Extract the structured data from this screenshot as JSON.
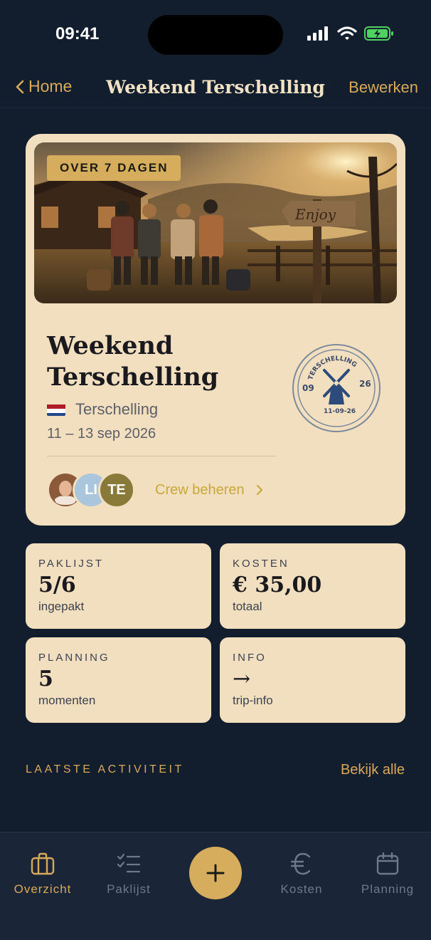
{
  "status": {
    "time": "09:41"
  },
  "nav": {
    "back_label": "Home",
    "title": "Weekend Terschelling",
    "edit_label": "Bewerken"
  },
  "trip": {
    "badge": "OVER 7 DAGEN",
    "sign_text": "Enjoy",
    "title": "Weekend Terschelling",
    "location": "Terschelling",
    "flag": "netherlands-flag",
    "dates": "11 – 13 sep 2026",
    "stamp": {
      "name": "TERSCHELLING",
      "left": "09",
      "right": "26",
      "date": "11-09-26"
    },
    "crew": {
      "avatars": [
        {
          "type": "photo",
          "color": "#c99a7a"
        },
        {
          "initials": "LI",
          "color": "#a9c6dc"
        },
        {
          "initials": "TE",
          "color": "#8a7a3a"
        }
      ],
      "link_label": "Crew beheren"
    }
  },
  "tiles": [
    {
      "label": "PAKLIJST",
      "value": "5/6",
      "sub": "ingepakt"
    },
    {
      "label": "KOSTEN",
      "value": "€ 35,00",
      "sub": "totaal"
    },
    {
      "label": "PLANNING",
      "value": "5",
      "sub": "momenten"
    },
    {
      "label": "INFO",
      "value": "→",
      "sub": "trip-info"
    }
  ],
  "activity": {
    "section_label": "LAATSTE ACTIVITEIT",
    "see_all": "Bekijk alle"
  },
  "tabbar": {
    "items": [
      {
        "label": "Overzicht",
        "icon": "suitcase-icon",
        "active": true
      },
      {
        "label": "Paklijst",
        "icon": "checklist-icon",
        "active": false
      },
      {
        "label": "Kosten",
        "icon": "euro-icon",
        "active": false
      },
      {
        "label": "Planning",
        "icon": "calendar-icon",
        "active": false
      }
    ],
    "fab_icon": "plus-icon"
  },
  "colors": {
    "background": "#121d2e",
    "card": "#f2dfbf",
    "accent": "#d9a95a",
    "tab_bar": "#1a2637"
  }
}
